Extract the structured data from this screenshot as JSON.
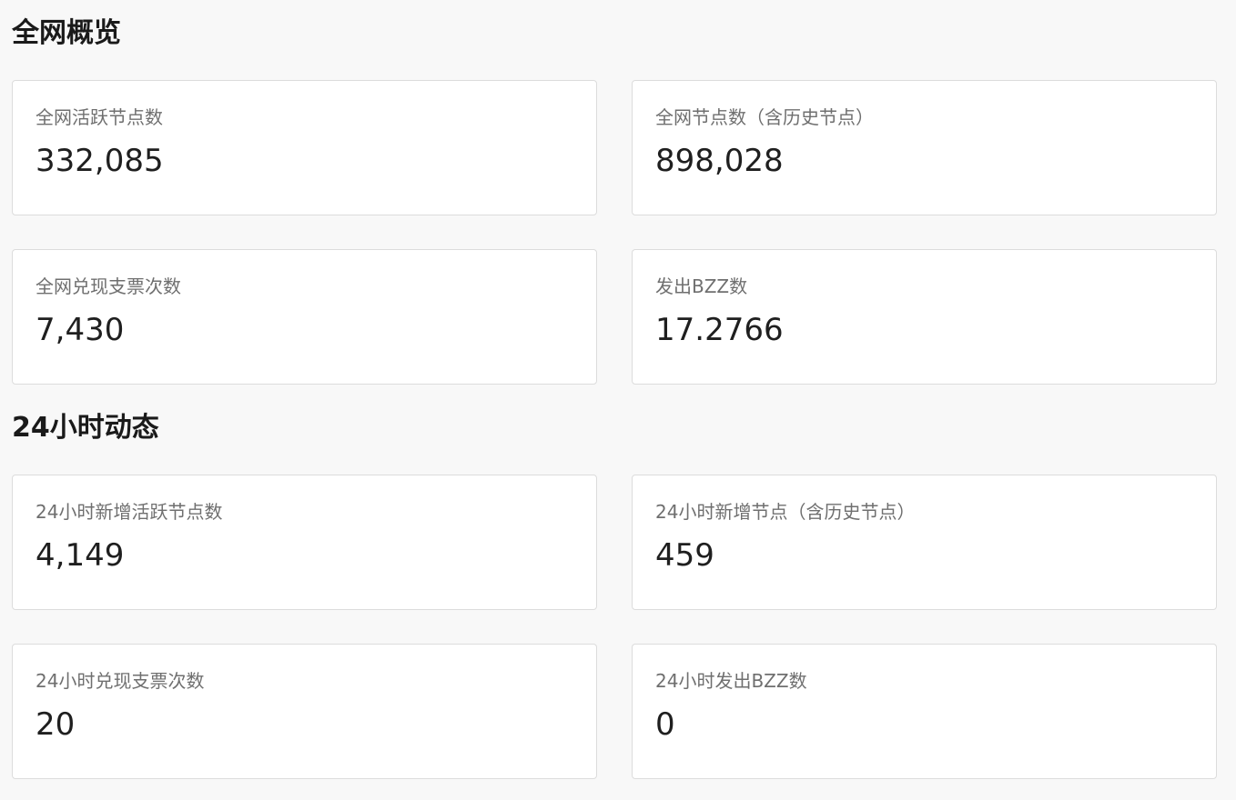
{
  "overview": {
    "title": "全网概览",
    "cards": [
      {
        "label": "全网活跃节点数",
        "value": "332,085"
      },
      {
        "label": "全网节点数（含历史节点）",
        "value": "898,028"
      },
      {
        "label": "全网兑现支票次数",
        "value": "7,430"
      },
      {
        "label": "发出BZZ数",
        "value": "17.2766"
      }
    ]
  },
  "dynamics": {
    "title": "24小时动态",
    "cards": [
      {
        "label": "24小时新增活跃节点数",
        "value": "4,149"
      },
      {
        "label": "24小时新增节点（含历史节点）",
        "value": "459"
      },
      {
        "label": "24小时兑现支票次数",
        "value": "20"
      },
      {
        "label": "24小时发出BZZ数",
        "value": "0"
      }
    ]
  }
}
